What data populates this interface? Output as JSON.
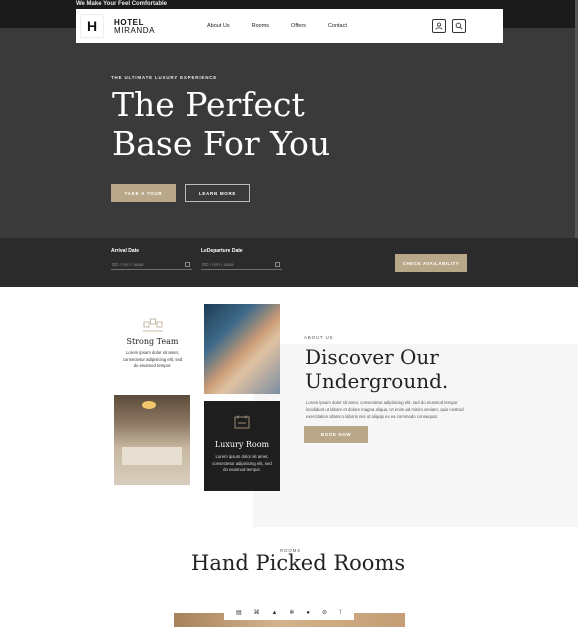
{
  "topbar": {
    "text": "We Make Your Feel Comfortable"
  },
  "nav": {
    "logo_letter": "H",
    "logo_line1": "HOTEL",
    "logo_line2": "MIRANDA",
    "links": [
      "About Us",
      "Rooms",
      "Offers",
      "Contact"
    ],
    "icons": [
      "user-icon",
      "search-icon"
    ]
  },
  "hero": {
    "eyebrow": "THE ULTIMATE LUXURY EXPERIENCE",
    "title_line1": "The Perfect",
    "title_line2": "Base For You",
    "primary_button": "TAKE A TOUR",
    "secondary_button": "LEARN MORE"
  },
  "booking": {
    "arrival_label": "Arrival Date",
    "departure_label": "LeDeparture Date",
    "date_placeholder": "DD / mm / aaaa",
    "check_button": "CHECK AVAILABILITY"
  },
  "features": {
    "team_title": "Strong Team",
    "team_desc": "Lorem ipsum dolor sit amet, consectetur adipisicing elit, sed do eiusmod tempor.",
    "luxury_title": "Luxury Room",
    "luxury_desc": "Lorem ipsum dolor sit amet, consectetur adipisicing elit, sed do eiusmod tempor."
  },
  "about": {
    "eyebrow": "ABOUT US",
    "title_line1": "Discover Our",
    "title_line2": "Underground.",
    "desc": "Lorem ipsum dolor sit amet, consectetur adipisicing elit, sed do eiusmod tempor incididunt ut labore et dolore magna aliqua. Ut enim ad minim veniam, quis nostrud exercitation ullamco laboris nisi ut aliquip ex ea commodo consequat.",
    "button": "BOOK NOW"
  },
  "rooms": {
    "eyebrow": "ROOMS",
    "title": "Hand Picked Rooms",
    "amenity_icons": [
      "bed-icon",
      "wifi-icon",
      "car-icon",
      "snowflake-icon",
      "gym-icon",
      "no-smoking-icon",
      "cocktail-icon"
    ]
  },
  "colors": {
    "accent": "#b9a78a",
    "hero_bg": "#3a3a3a",
    "booking_bg": "#2b2b2b"
  }
}
